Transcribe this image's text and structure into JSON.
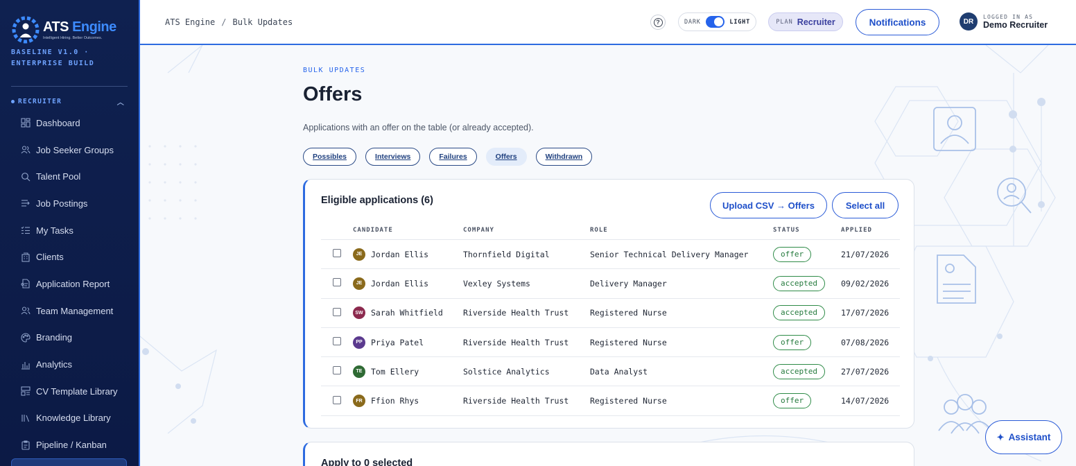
{
  "brand": {
    "name_part1": "ATS",
    "name_part2": "Engine",
    "tagline": "Intelligent Hiring. Better Outcomes.",
    "build": "BASELINE V1.0 · ENTERPRISE BUILD"
  },
  "sidebar": {
    "section_label": "RECRUITER",
    "items": [
      {
        "label": "Dashboard",
        "icon": "dashboard-icon"
      },
      {
        "label": "Job Seeker Groups",
        "icon": "users-icon"
      },
      {
        "label": "Talent Pool",
        "icon": "search-icon"
      },
      {
        "label": "Job Postings",
        "icon": "list-arrow-icon"
      },
      {
        "label": "My Tasks",
        "icon": "tasks-icon"
      },
      {
        "label": "Clients",
        "icon": "building-icon"
      },
      {
        "label": "Application Report",
        "icon": "report-icon"
      },
      {
        "label": "Team Management",
        "icon": "team-icon"
      },
      {
        "label": "Branding",
        "icon": "palette-icon"
      },
      {
        "label": "Analytics",
        "icon": "bar-chart-icon"
      },
      {
        "label": "CV Template Library",
        "icon": "template-icon"
      },
      {
        "label": "Knowledge Library",
        "icon": "library-icon"
      },
      {
        "label": "Pipeline / Kanban",
        "icon": "clipboard-icon"
      }
    ]
  },
  "header": {
    "breadcrumb": [
      "ATS Engine",
      "Bulk Updates"
    ],
    "help_icon": "?",
    "theme": {
      "dark_label": "DARK",
      "light_label": "LIGHT",
      "selected": "light"
    },
    "plan": {
      "label": "PLAN",
      "value": "Recruiter"
    },
    "notifications_label": "Notifications",
    "user": {
      "initials": "DR",
      "label": "LOGGED IN AS",
      "name": "Demo Recruiter"
    }
  },
  "page": {
    "eyebrow": "BULK UPDATES",
    "title": "Offers",
    "subtitle": "Applications with an offer on the table (or already accepted).",
    "tabs": [
      {
        "label": "Possibles",
        "active": false
      },
      {
        "label": "Interviews",
        "active": false
      },
      {
        "label": "Failures",
        "active": false
      },
      {
        "label": "Offers",
        "active": true
      },
      {
        "label": "Withdrawn",
        "active": false
      }
    ]
  },
  "eligible": {
    "title": "Eligible applications (6)",
    "upload_label": "Upload CSV → Offers",
    "select_all_label": "Select all",
    "columns": [
      "CANDIDATE",
      "COMPANY",
      "ROLE",
      "STATUS",
      "APPLIED"
    ],
    "rows": [
      {
        "initials": "JE",
        "color": "#8a6a1c",
        "candidate": "Jordan Ellis",
        "company": "Thornfield Digital",
        "role": "Senior Technical Delivery Manager",
        "status": "offer",
        "applied": "21/07/2026"
      },
      {
        "initials": "JE",
        "color": "#8a6a1c",
        "candidate": "Jordan Ellis",
        "company": "Vexley Systems",
        "role": "Delivery Manager",
        "status": "accepted",
        "applied": "09/02/2026"
      },
      {
        "initials": "SW",
        "color": "#8c2a4e",
        "candidate": "Sarah Whitfield",
        "company": "Riverside Health Trust",
        "role": "Registered Nurse",
        "status": "accepted",
        "applied": "17/07/2026"
      },
      {
        "initials": "PP",
        "color": "#5b3a8e",
        "candidate": "Priya Patel",
        "company": "Riverside Health Trust",
        "role": "Registered Nurse",
        "status": "offer",
        "applied": "07/08/2026"
      },
      {
        "initials": "TE",
        "color": "#2f6a34",
        "candidate": "Tom Ellery",
        "company": "Solstice Analytics",
        "role": "Data Analyst",
        "status": "accepted",
        "applied": "27/07/2026"
      },
      {
        "initials": "FR",
        "color": "#8a6a1c",
        "candidate": "Ffion Rhys",
        "company": "Riverside Health Trust",
        "role": "Registered Nurse",
        "status": "offer",
        "applied": "14/07/2026"
      }
    ]
  },
  "apply": {
    "title": "Apply to 0 selected"
  },
  "assistant": {
    "label": "Assistant",
    "icon": "sparkle-icon"
  },
  "colors": {
    "accent": "#2d6be0",
    "sidebar_bg": "#0f2150",
    "status_green": "#2e8b47"
  }
}
